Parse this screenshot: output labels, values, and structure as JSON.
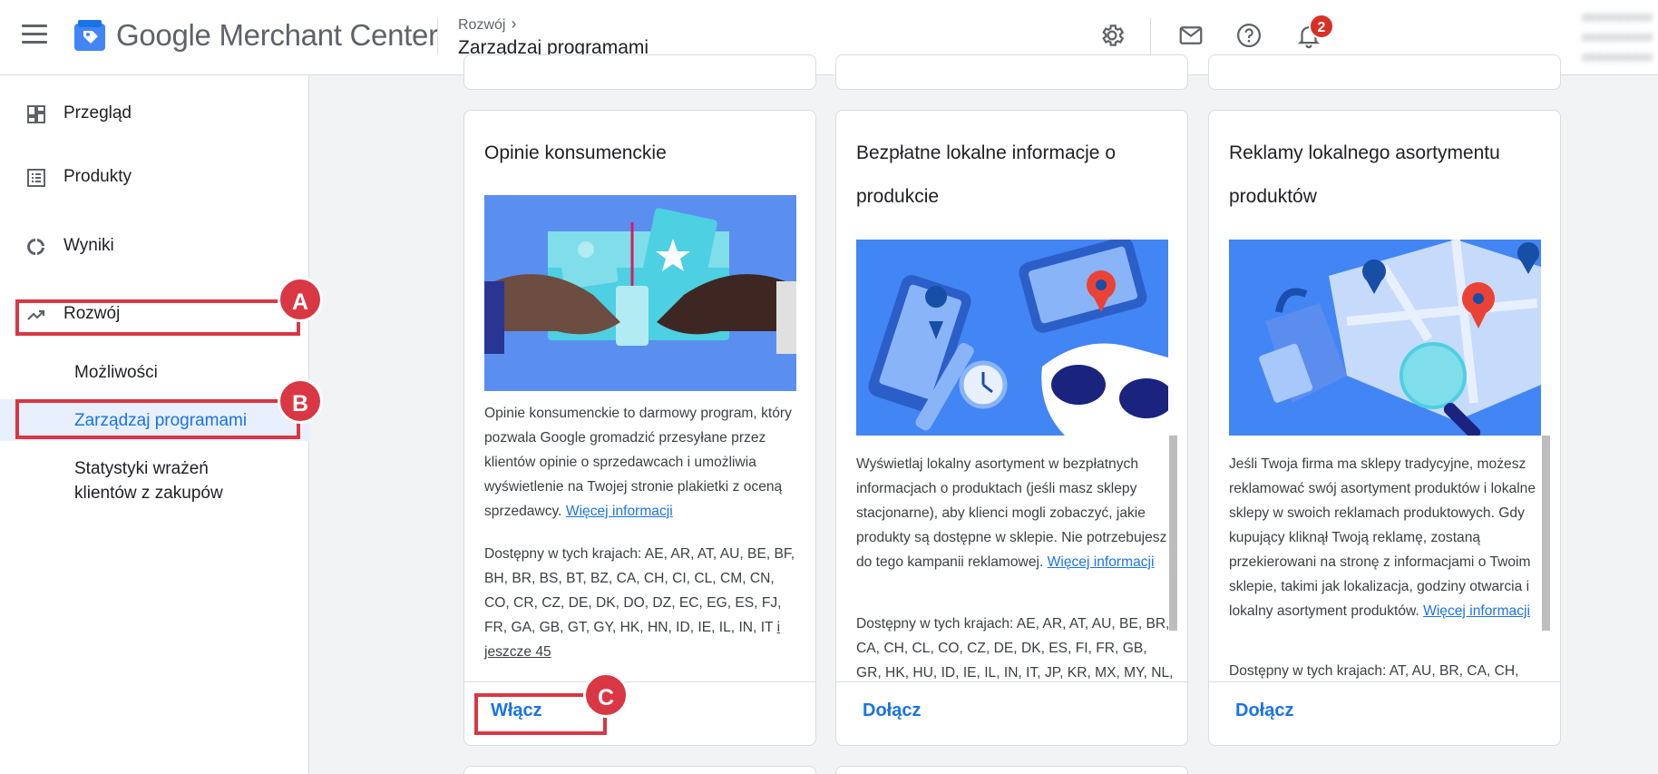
{
  "header": {
    "app_name": "Google Merchant Center",
    "breadcrumb": "Rozwój",
    "page_title": "Zarządzaj programami",
    "notification_count": "2",
    "account_lines": [
      "##########",
      "##########",
      "##########"
    ]
  },
  "sidebar": {
    "items": [
      {
        "label": "Przegląd",
        "icon": "dashboard-icon"
      },
      {
        "label": "Produkty",
        "icon": "list-icon"
      },
      {
        "label": "Wyniki",
        "icon": "donut-chart-icon"
      },
      {
        "label": "Rozwój",
        "icon": "trending-up-icon"
      }
    ],
    "sub_items": [
      {
        "label": "Możliwości"
      },
      {
        "label": "Zarządzaj programami"
      },
      {
        "label": "Statystyki wrażeń klientów z zakupów"
      }
    ]
  },
  "callouts": [
    "A",
    "B",
    "C"
  ],
  "cards": [
    {
      "title": "Opinie konsumenckie",
      "description": "Opinie konsumenckie to darmowy program, który pozwala Google gromadzić przesyłane przez klientów opinie o sprzedawcach i umożliwia wyświetlenie na Twojej stronie plakietki z oceną sprzedawcy.",
      "link": "Więcej informacji",
      "countries": "Dostępny w tych krajach: AE, AR, AT, AU, BE, BF, BH, BR, BS, BT, BZ, CA, CH, CI, CL, CM, CN, CO, CR, CZ, DE, DK, DO, DZ, EC, EG, ES, FJ, FR, GA, GB, GT, GY, HK, HN, ID, IE, IL, IN, IT",
      "countries_more": "i jeszcze 45",
      "action": "Włącz"
    },
    {
      "title": "Bezpłatne lokalne informacje o produkcie",
      "description": "Wyświetlaj lokalny asortyment w bezpłatnych informacjach o produktach (jeśli masz sklepy stacjonarne), aby klienci mogli zobaczyć, jakie produkty są dostępne w sklepie. Nie potrzebujesz do tego kampanii reklamowej.",
      "link": "Więcej informacji",
      "countries": "Dostępny w tych krajach: AE, AR, AT, AU, BE, BR, CA, CH, CL, CO, CZ, DE, DK, ES, FI, FR, GB, GR, HK, HU, ID, IE, IL, IN, IT, JP, KR, MX, MY, NL,",
      "action": "Dołącz"
    },
    {
      "title": "Reklamy lokalnego asortymentu produktów",
      "description": "Jeśli Twoja firma ma sklepy tradycyjne, możesz reklamować swój asortyment produktów i lokalne sklepy w swoich reklamach produktowych. Gdy kupujący kliknął Twoją reklamę, zostaną przekierowani na stronę z informacjami o Twoim sklepie, takimi jak lokalizacja, godziny otwarcia i lokalny asortyment produktów.",
      "link": "Więcej informacji",
      "countries": "Dostępny w tych krajach: AT, AU, BR, CA, CH,",
      "action": "Dołącz"
    }
  ],
  "colors": {
    "accent": "#1a73e8",
    "callout": "#d93743",
    "badge": "#d93025"
  }
}
